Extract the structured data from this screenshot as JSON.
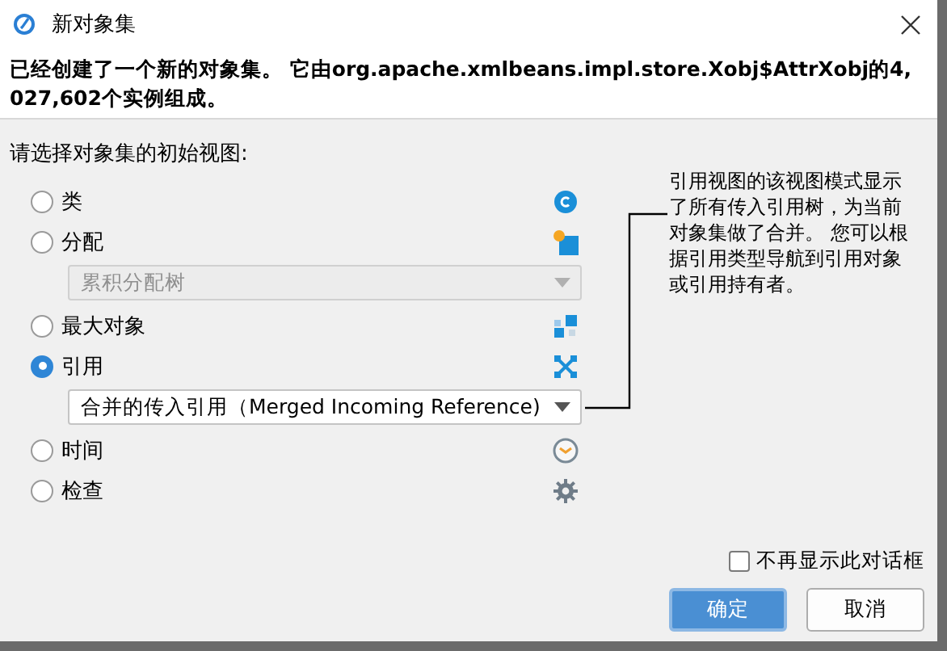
{
  "window": {
    "title": "新对象集"
  },
  "message": "已经创建了一个新的对象集。 它由org.apache.xmlbeans.impl.store.Xobj$AttrXobj的4,027,602个实例组成。",
  "prompt": "请选择对象集的初始视图:",
  "options": [
    {
      "label": "类",
      "selected": false
    },
    {
      "label": "分配",
      "selected": false,
      "dropdown": {
        "value": "累积分配树",
        "disabled": true
      }
    },
    {
      "label": "最大对象",
      "selected": false
    },
    {
      "label": "引用",
      "selected": true,
      "dropdown": {
        "value": "合并的传入引用（Merged Incoming Reference)",
        "disabled": false
      }
    },
    {
      "label": "时间",
      "selected": false
    },
    {
      "label": "检查",
      "selected": false
    }
  ],
  "description": "引用视图的该视图模式显示了所有传入引用树，为当前对象集做了合并。 您可以根据引用类型导航到引用对象或引用持有者。",
  "dont_show_again": {
    "label": "不再显示此对话框",
    "checked": false
  },
  "buttons": [
    {
      "label": "确定",
      "kind": "primary"
    },
    {
      "label": "取消",
      "kind": "secondary"
    }
  ]
}
